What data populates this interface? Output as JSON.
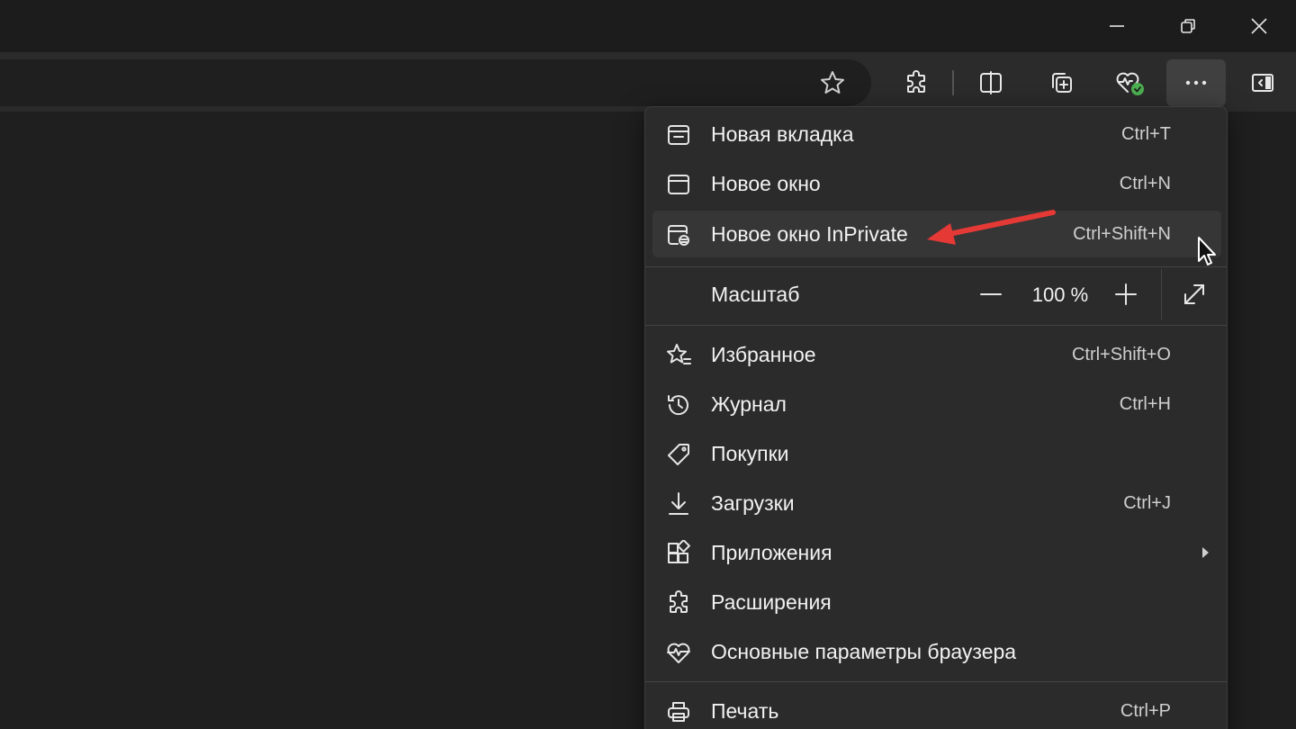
{
  "menu": {
    "items_top": [
      {
        "label": "Новая вкладка",
        "shortcut": "Ctrl+T",
        "icon": "new-tab-icon"
      },
      {
        "label": "Новое окно",
        "shortcut": "Ctrl+N",
        "icon": "new-window-icon"
      },
      {
        "label": "Новое окно InPrivate",
        "shortcut": "Ctrl+Shift+N",
        "icon": "inprivate-icon"
      }
    ],
    "zoom": {
      "label": "Масштаб",
      "value": "100 %"
    },
    "items_main": [
      {
        "label": "Избранное",
        "shortcut": "Ctrl+Shift+O",
        "icon": "favorites-icon"
      },
      {
        "label": "Журнал",
        "shortcut": "Ctrl+H",
        "icon": "history-icon"
      },
      {
        "label": "Покупки",
        "shortcut": "",
        "icon": "tag-icon"
      },
      {
        "label": "Загрузки",
        "shortcut": "Ctrl+J",
        "icon": "download-icon"
      },
      {
        "label": "Приложения",
        "shortcut": "",
        "icon": "apps-icon"
      },
      {
        "label": "Расширения",
        "shortcut": "",
        "icon": "extensions-icon"
      },
      {
        "label": "Основные параметры браузера",
        "shortcut": "",
        "icon": "heart-pulse-icon"
      }
    ],
    "items_bottom": [
      {
        "label": "Печать",
        "shortcut": "Ctrl+P",
        "icon": "printer-icon"
      }
    ]
  },
  "colors": {
    "annotation_arrow": "#e53935",
    "status_green": "#4caf50"
  }
}
